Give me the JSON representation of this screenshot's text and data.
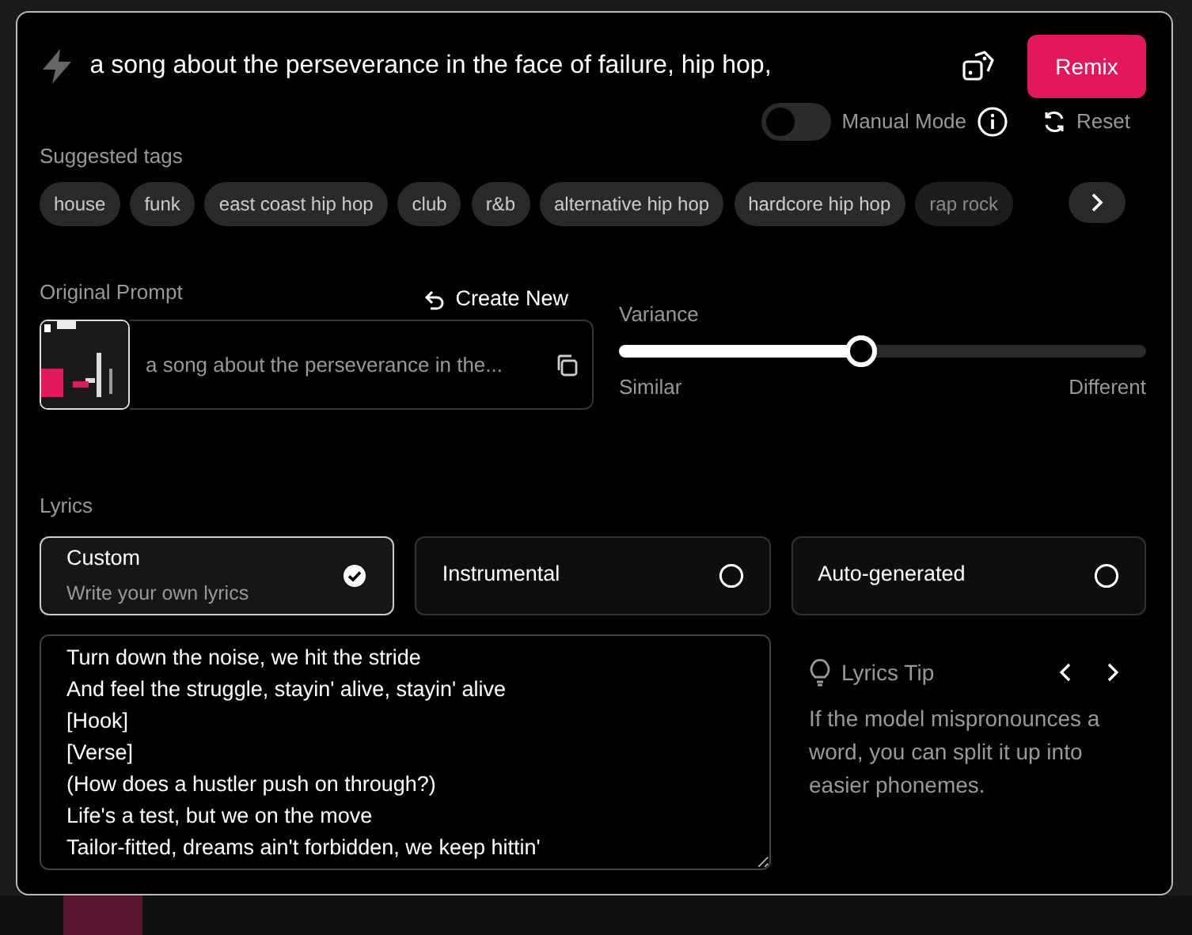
{
  "prompt": {
    "text": "a song about the perseverance in the face of failure, hip hop,"
  },
  "remix_button": "Remix",
  "manual_mode": {
    "label": "Manual Mode",
    "on": false
  },
  "reset": "Reset",
  "suggested_tags": {
    "title": "Suggested tags",
    "tags": [
      {
        "label": "house",
        "faded": false
      },
      {
        "label": "funk",
        "faded": false
      },
      {
        "label": "east coast hip hop",
        "faded": false
      },
      {
        "label": "club",
        "faded": false
      },
      {
        "label": "r&b",
        "faded": false
      },
      {
        "label": "alternative hip hop",
        "faded": false
      },
      {
        "label": "hardcore hip hop",
        "faded": false
      },
      {
        "label": "rap rock",
        "faded": true
      }
    ]
  },
  "original_prompt": {
    "title": "Original Prompt",
    "create_new": "Create New",
    "text": "a song about the perseverance in the..."
  },
  "variance": {
    "title": "Variance",
    "level": 0.46,
    "min_label": "Similar",
    "max_label": "Different"
  },
  "lyrics": {
    "title": "Lyrics",
    "options": [
      {
        "label": "Custom",
        "sublabel": "Write your own lyrics",
        "selected": true
      },
      {
        "label": "Instrumental",
        "selected": false
      },
      {
        "label": "Auto-generated",
        "selected": false
      }
    ],
    "lines": [
      "Turn down the noise, we hit the stride",
      "And feel the struggle, stayin' alive, stayin' alive",
      "[Hook]",
      "[Verse]",
      "(How does a hustler push on through?)",
      "Life's a test, but we on the move",
      "Tailor-fitted, dreams ain't forbidden, we keep hittin'"
    ]
  },
  "tip": {
    "title": "Lyrics Tip",
    "text": "If the model mispronounces a word, you can split it up into easier phonemes."
  }
}
